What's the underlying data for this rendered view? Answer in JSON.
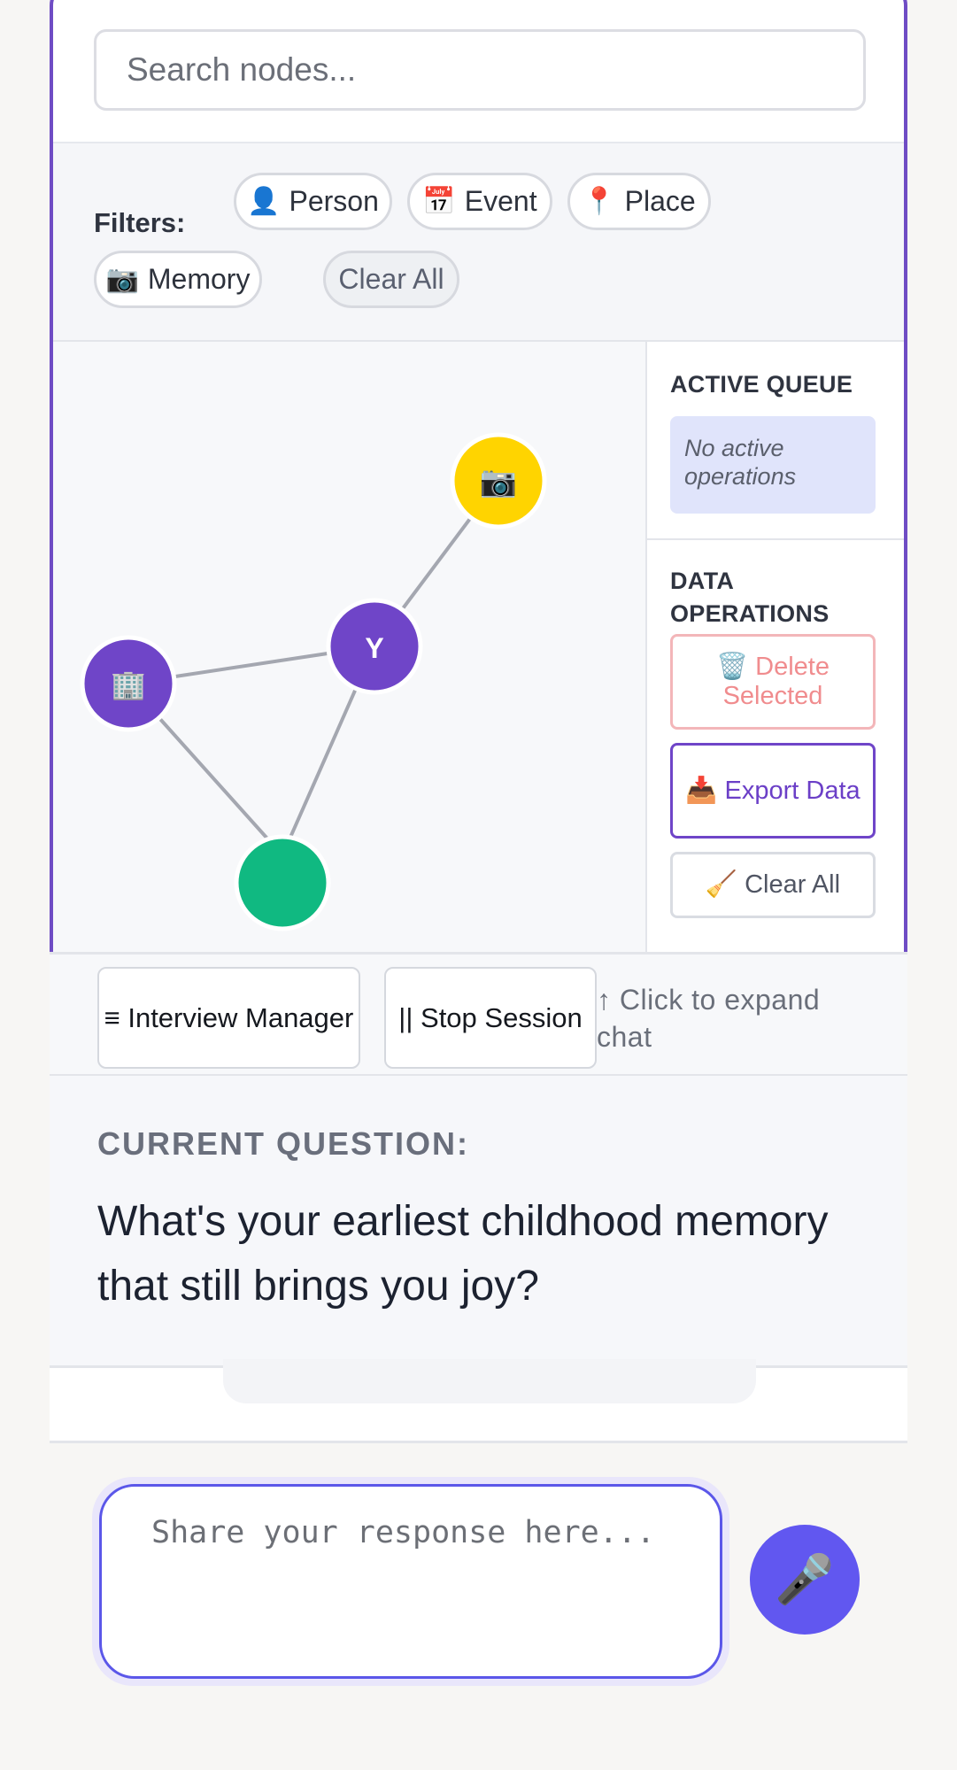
{
  "search": {
    "placeholder": "Search nodes..."
  },
  "filters": {
    "label": "Filters:",
    "chips": [
      {
        "icon": "👤",
        "icon_name": "person-icon",
        "label": "Person"
      },
      {
        "icon": "📅",
        "icon_name": "calendar-icon",
        "label": "Event"
      },
      {
        "icon": "📍",
        "icon_name": "pin-icon",
        "label": "Place"
      },
      {
        "icon": "📷",
        "icon_name": "camera-icon",
        "label": "Memory"
      }
    ],
    "clear_label": "Clear All"
  },
  "graph": {
    "nodes": [
      {
        "id": "memory",
        "icon": "📷",
        "icon_name": "camera-icon",
        "color": "#ffd400"
      },
      {
        "id": "you",
        "icon": "Y",
        "icon_name": "user-initial",
        "color": "#6f45c8"
      },
      {
        "id": "place",
        "icon": "🏢",
        "icon_name": "building-icon",
        "color": "#6f45c8"
      },
      {
        "id": "event",
        "icon": "",
        "icon_name": "event-node",
        "color": "#10b981"
      }
    ],
    "edge_color": "#a4a7b0"
  },
  "queue": {
    "title": "ACTIVE QUEUE",
    "empty_text": "No active operations"
  },
  "data_ops": {
    "title": "DATA OPERATIONS",
    "delete_label": "🗑️ Delete Selected",
    "export_label": "📥 Export Data",
    "clear_label": "🧹 Clear All"
  },
  "toolbar": {
    "interview_label": "≡ Interview Manager",
    "stop_label": "|| Stop Session",
    "expand_hint": "↑ Click to expand chat"
  },
  "question": {
    "label": "CURRENT QUESTION:",
    "text": "What's your earliest childhood memory that still brings you joy?"
  },
  "response": {
    "placeholder": "Share your response here...",
    "mic_icon": "🎤"
  },
  "colors": {
    "accent": "#6f4cc4",
    "mic": "#6157f0",
    "input_border": "#5b57e9"
  }
}
